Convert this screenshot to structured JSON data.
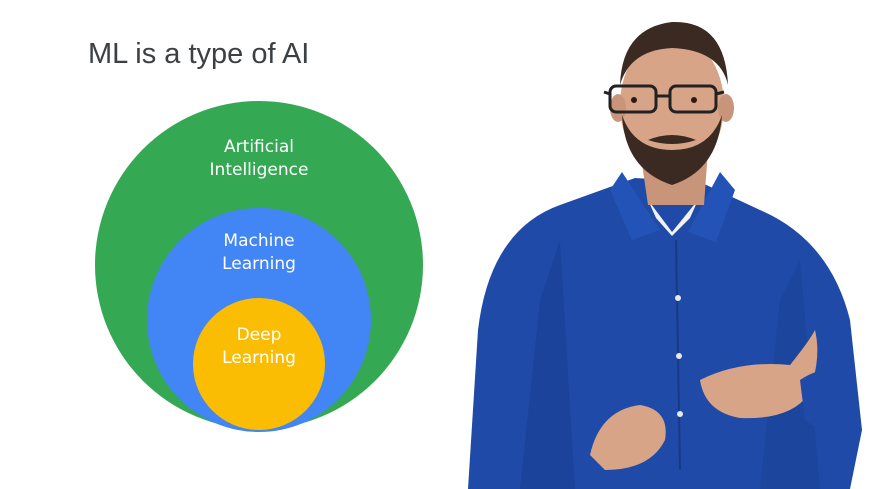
{
  "slide": {
    "title": "ML is a type of AI"
  },
  "diagram": {
    "type": "nested-circles",
    "circles": [
      {
        "line1": "Artificial",
        "line2": "Intelligence",
        "color": "#34a853"
      },
      {
        "line1": "Machine",
        "line2": "Learning",
        "color": "#4285f4"
      },
      {
        "line1": "Deep",
        "line2": "Learning",
        "color": "#fbbc04"
      }
    ]
  },
  "presenter": {
    "icon": "presenter-person",
    "shirt_color": "#1f4aa8"
  }
}
